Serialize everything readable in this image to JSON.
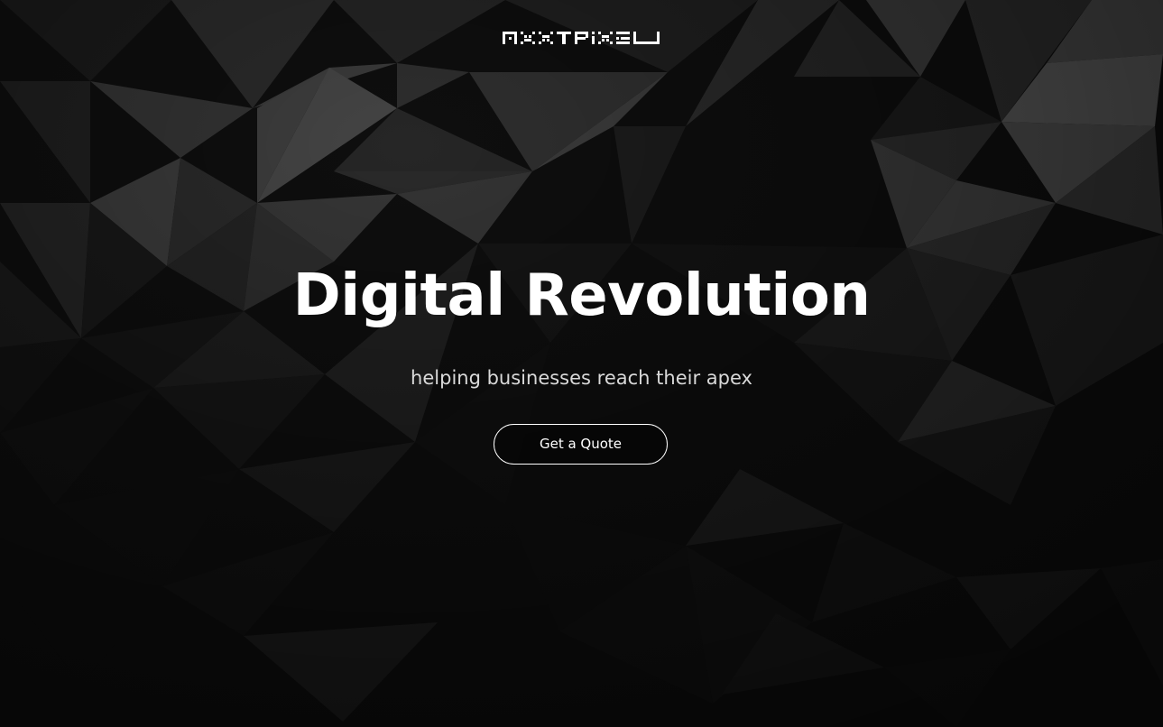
{
  "brand": {
    "logo_text": "NEXTPIXEL",
    "logo_icon": "nextpixel-wordmark"
  },
  "hero": {
    "title": "Digital Revolution",
    "subtitle": "helping businesses reach their apex",
    "cta_label": "Get a Quote",
    "background": "dark-low-poly-triangles"
  },
  "colors": {
    "background": "#0d0d0d",
    "text": "#ffffff",
    "subtitle": "#d9d9d9",
    "button_border": "#ffffff"
  }
}
